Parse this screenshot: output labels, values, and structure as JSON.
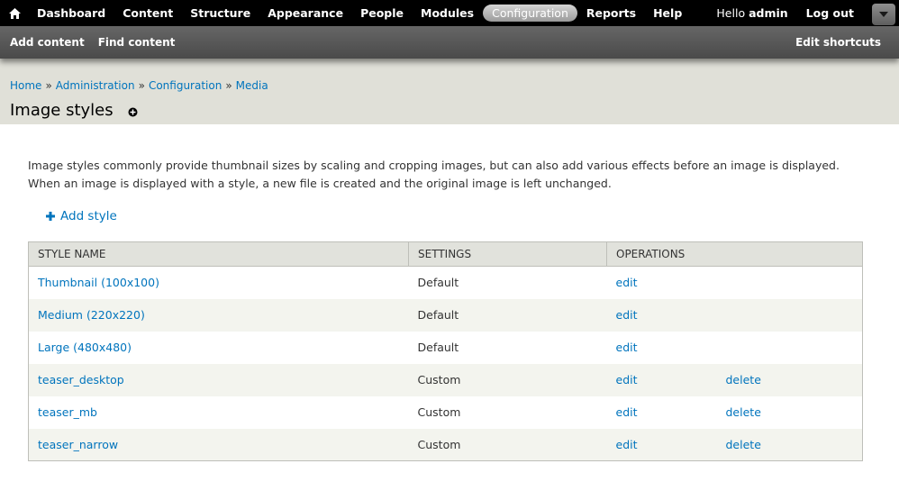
{
  "toolbar": {
    "home_icon": "home-icon",
    "menu": [
      {
        "label": "Dashboard",
        "active": false
      },
      {
        "label": "Content",
        "active": false
      },
      {
        "label": "Structure",
        "active": false
      },
      {
        "label": "Appearance",
        "active": false
      },
      {
        "label": "People",
        "active": false
      },
      {
        "label": "Modules",
        "active": false
      },
      {
        "label": "Configuration",
        "active": true
      },
      {
        "label": "Reports",
        "active": false
      },
      {
        "label": "Help",
        "active": false
      }
    ],
    "greeting_prefix": "Hello",
    "username": "admin",
    "logout_label": "Log out",
    "drawer_icon": "chevron-down-icon"
  },
  "shortcuts": {
    "items": [
      "Add content",
      "Find content"
    ],
    "edit_label": "Edit shortcuts"
  },
  "breadcrumb": {
    "items": [
      "Home",
      "Administration",
      "Configuration",
      "Media"
    ],
    "separator": "»"
  },
  "page": {
    "title": "Image styles",
    "add_shortcut_icon": "plus-circle-icon"
  },
  "content": {
    "description": "Image styles commonly provide thumbnail sizes by scaling and cropping images, but can also add various effects before an image is displayed. When an image is displayed with a style, a new file is created and the original image is left unchanged.",
    "add_style_label": "Add style"
  },
  "table": {
    "headers": [
      "STYLE NAME",
      "SETTINGS",
      "OPERATIONS"
    ],
    "rows": [
      {
        "name": "Thumbnail (100x100)",
        "settings": "Default",
        "edit": "edit",
        "delete": ""
      },
      {
        "name": "Medium (220x220)",
        "settings": "Default",
        "edit": "edit",
        "delete": ""
      },
      {
        "name": "Large (480x480)",
        "settings": "Default",
        "edit": "edit",
        "delete": ""
      },
      {
        "name": "teaser_desktop",
        "settings": "Custom",
        "edit": "edit",
        "delete": "delete"
      },
      {
        "name": "teaser_mb",
        "settings": "Custom",
        "edit": "edit",
        "delete": "delete"
      },
      {
        "name": "teaser_narrow",
        "settings": "Custom",
        "edit": "edit",
        "delete": "delete"
      }
    ]
  },
  "colors": {
    "toolbar_bg": "#000000",
    "shortcuts_bg": "#555555",
    "header_bg": "#e0e0d8",
    "link": "#0074bd",
    "row_alt": "#f3f4ee",
    "table_header_bg": "#e1e2dc"
  }
}
